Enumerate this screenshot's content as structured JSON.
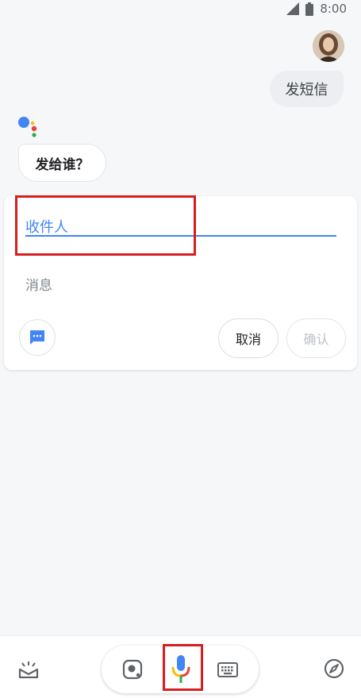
{
  "status_bar": {
    "time": "8:00"
  },
  "conversation": {
    "user_message": "发短信",
    "assistant_prompt": "发给谁？"
  },
  "sms_card": {
    "recipient_placeholder": "收件人",
    "message_placeholder": "消息",
    "cancel_label": "取消",
    "confirm_label": "确认"
  },
  "colors": {
    "accent_blue": "#4285f4",
    "highlight_red": "#d71e1e"
  }
}
